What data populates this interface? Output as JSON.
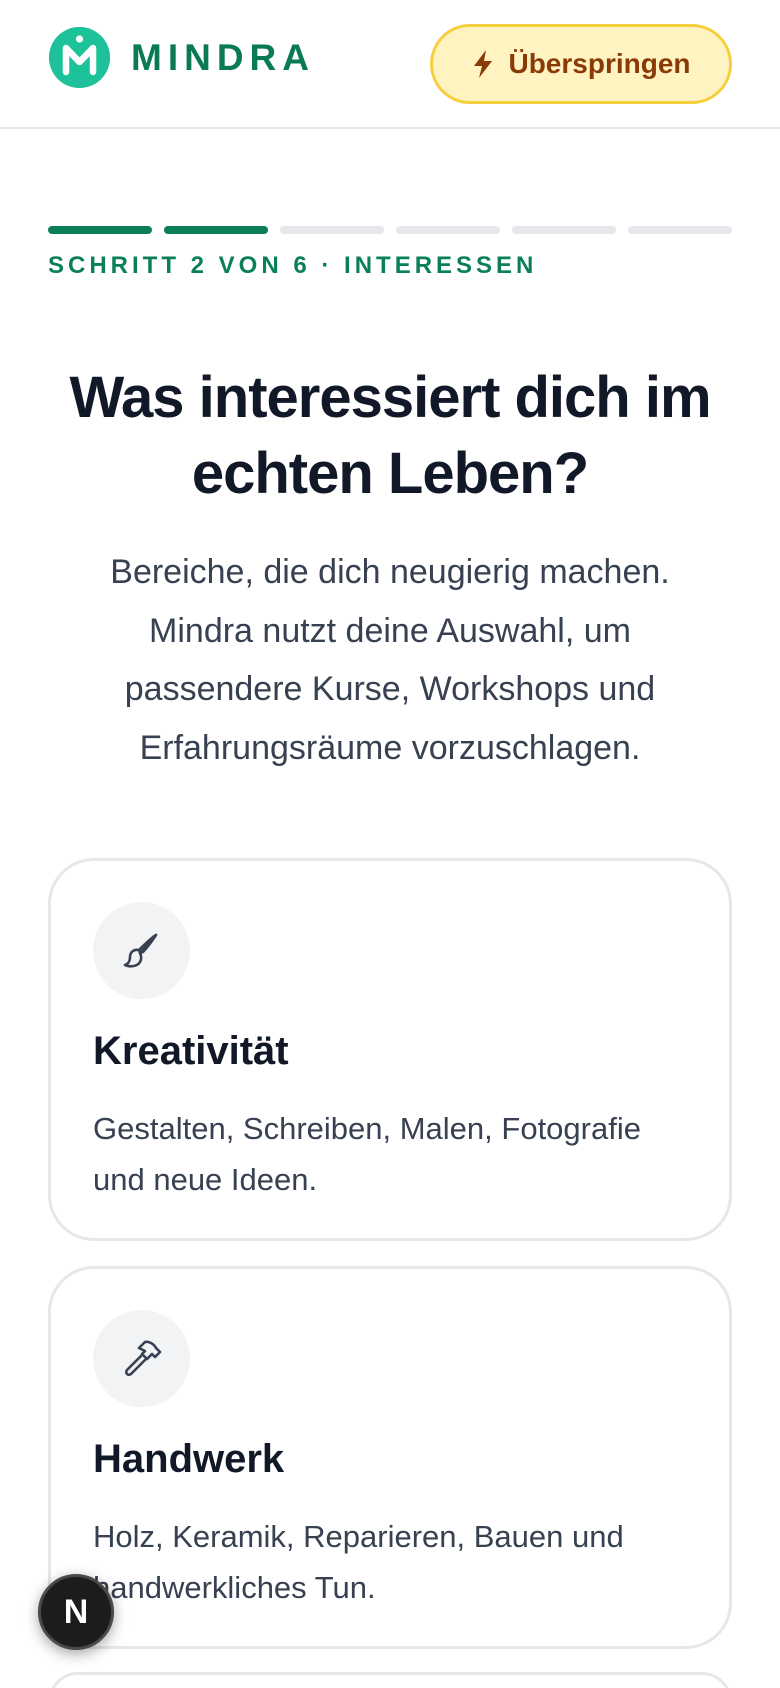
{
  "brand": {
    "name": "MINDRA",
    "logo_letter": "M",
    "colors": {
      "primary": "#0b8058",
      "logo_bg": "#1ec29a"
    }
  },
  "header": {
    "skip_label": "Überspringen",
    "skip_icon": "bolt-icon"
  },
  "progress": {
    "current_step": 2,
    "total_steps": 6,
    "label": "SCHRITT 2 VON 6 · INTERESSEN"
  },
  "main": {
    "title": "Was interessiert dich im echten Leben?",
    "subtitle": "Bereiche, die dich neugierig machen. Mindra nutzt deine Auswahl, um passendere Kurse, Workshops und Erfahrungsräume vorzuschlagen."
  },
  "interests": [
    {
      "icon": "paintbrush-icon",
      "title": "Kreativität",
      "description": "Gestalten, Schreiben, Malen, Fotografie und neue Ideen."
    },
    {
      "icon": "hammer-icon",
      "title": "Handwerk",
      "description": "Holz, Keramik, Reparieren, Bauen und handwerkliches Tun."
    }
  ],
  "floating_badge": {
    "label": "N"
  }
}
